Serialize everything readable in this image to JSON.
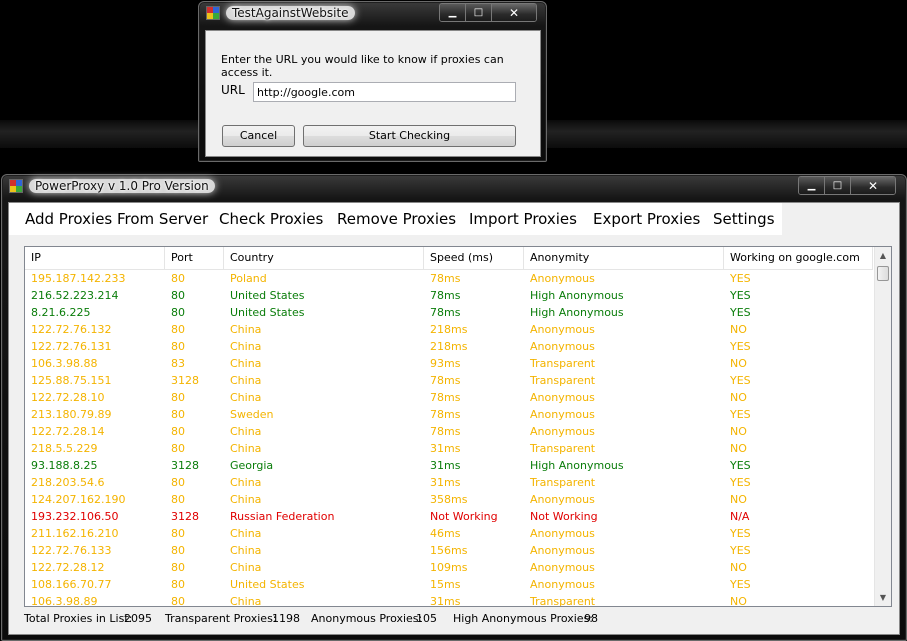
{
  "dialog": {
    "title": "TestAgainstWebsite",
    "prompt": "Enter the URL you would like to know if proxies can access it.",
    "url_label": "URL",
    "url_value": "http://google.com",
    "cancel_label": "Cancel",
    "start_label": "Start Checking"
  },
  "main": {
    "title": "PowerProxy v 1.0 Pro Version",
    "menu": [
      "Add Proxies From Server",
      "Check Proxies",
      "Remove Proxies",
      "Import Proxies",
      "Export Proxies",
      "Settings"
    ],
    "columns": [
      "IP",
      "Port",
      "Country",
      "Speed (ms)",
      "Anonymity",
      "Working on google.com"
    ],
    "rows": [
      {
        "ip": "195.187.142.233",
        "port": "80",
        "country": "Poland",
        "speed": "78ms",
        "anonymity": "Anonymous",
        "working": "YES",
        "status": "anon"
      },
      {
        "ip": "216.52.223.214",
        "port": "80",
        "country": "United States",
        "speed": "78ms",
        "anonymity": "High Anonymous",
        "working": "YES",
        "status": "high"
      },
      {
        "ip": "8.21.6.225",
        "port": "80",
        "country": "United States",
        "speed": "78ms",
        "anonymity": "High Anonymous",
        "working": "YES",
        "status": "high"
      },
      {
        "ip": "122.72.76.132",
        "port": "80",
        "country": "China",
        "speed": "218ms",
        "anonymity": "Anonymous",
        "working": "NO",
        "status": "anon"
      },
      {
        "ip": "122.72.76.131",
        "port": "80",
        "country": "China",
        "speed": "218ms",
        "anonymity": "Anonymous",
        "working": "YES",
        "status": "anon"
      },
      {
        "ip": "106.3.98.88",
        "port": "83",
        "country": "China",
        "speed": "93ms",
        "anonymity": "Transparent",
        "working": "NO",
        "status": "trans"
      },
      {
        "ip": "125.88.75.151",
        "port": "3128",
        "country": "China",
        "speed": "78ms",
        "anonymity": "Transparent",
        "working": "YES",
        "status": "trans"
      },
      {
        "ip": "122.72.28.10",
        "port": "80",
        "country": "China",
        "speed": "78ms",
        "anonymity": "Anonymous",
        "working": "NO",
        "status": "anon"
      },
      {
        "ip": "213.180.79.89",
        "port": "80",
        "country": "Sweden",
        "speed": "78ms",
        "anonymity": "Anonymous",
        "working": "YES",
        "status": "anon"
      },
      {
        "ip": "122.72.28.14",
        "port": "80",
        "country": "China",
        "speed": "78ms",
        "anonymity": "Anonymous",
        "working": "NO",
        "status": "anon"
      },
      {
        "ip": "218.5.5.229",
        "port": "80",
        "country": "China",
        "speed": "31ms",
        "anonymity": "Transparent",
        "working": "NO",
        "status": "trans"
      },
      {
        "ip": "93.188.8.25",
        "port": "3128",
        "country": "Georgia",
        "speed": "31ms",
        "anonymity": "High Anonymous",
        "working": "YES",
        "status": "high"
      },
      {
        "ip": "218.203.54.6",
        "port": "80",
        "country": "China",
        "speed": "31ms",
        "anonymity": "Transparent",
        "working": "YES",
        "status": "trans"
      },
      {
        "ip": "124.207.162.190",
        "port": "80",
        "country": "China",
        "speed": "358ms",
        "anonymity": "Anonymous",
        "working": "NO",
        "status": "anon"
      },
      {
        "ip": "193.232.106.50",
        "port": "3128",
        "country": "Russian Federation",
        "speed": "Not Working",
        "anonymity": "Not Working",
        "working": "N/A",
        "status": "dead"
      },
      {
        "ip": "211.162.16.210",
        "port": "80",
        "country": "China",
        "speed": "46ms",
        "anonymity": "Anonymous",
        "working": "YES",
        "status": "anon"
      },
      {
        "ip": "122.72.76.133",
        "port": "80",
        "country": "China",
        "speed": "156ms",
        "anonymity": "Anonymous",
        "working": "YES",
        "status": "anon"
      },
      {
        "ip": "122.72.28.12",
        "port": "80",
        "country": "China",
        "speed": "109ms",
        "anonymity": "Anonymous",
        "working": "NO",
        "status": "anon"
      },
      {
        "ip": "108.166.70.77",
        "port": "80",
        "country": "United States",
        "speed": "15ms",
        "anonymity": "Anonymous",
        "working": "YES",
        "status": "anon"
      },
      {
        "ip": "106.3.98.89",
        "port": "80",
        "country": "China",
        "speed": "31ms",
        "anonymity": "Transparent",
        "working": "NO",
        "status": "trans"
      }
    ],
    "status": {
      "total_label": "Total Proxies in List:",
      "total_value": "2095",
      "transparent_label": "Transparent Proxies:",
      "transparent_value": "1198",
      "anonymous_label": "Anonymous Proxies:",
      "anonymous_value": "105",
      "high_label": "High Anonymous Proxies:",
      "high_value": "98"
    }
  },
  "colors": {
    "high_anonymous": "#0a7d0a",
    "anonymous": "#f4b400",
    "transparent": "#f4b400",
    "not_working": "#e00000"
  }
}
